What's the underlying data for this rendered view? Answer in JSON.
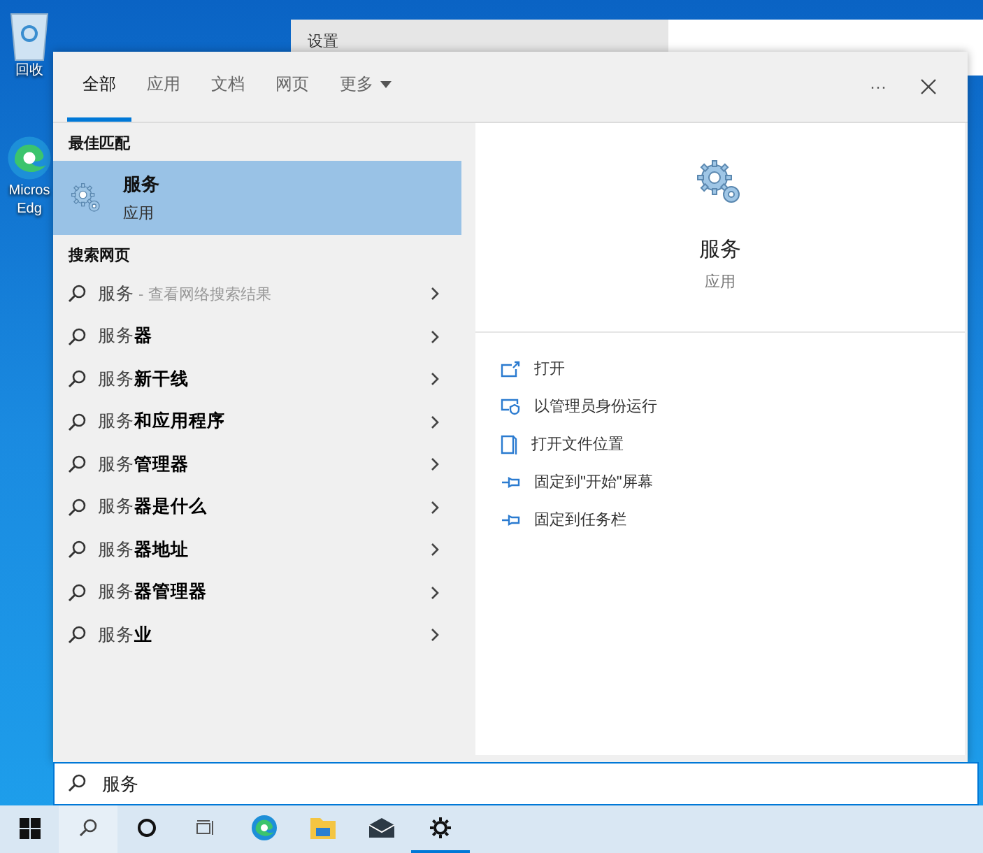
{
  "desktop_icons": [
    {
      "kind": "recycle",
      "label": "回收"
    },
    {
      "kind": "edge",
      "label": "Micros",
      "label_2": "Edg"
    }
  ],
  "background_window": {
    "title": "设置"
  },
  "search_panel": {
    "tabs": [
      {
        "label": "全部",
        "selected": true
      },
      {
        "label": "应用",
        "selected": false
      },
      {
        "label": "文档",
        "selected": false
      },
      {
        "label": "网页",
        "selected": false
      },
      {
        "label": "更多",
        "selected": false,
        "dropdown": true
      }
    ],
    "more_button": "···",
    "best_match": {
      "heading": "最佳匹配",
      "title": "服务",
      "subtitle": "应用",
      "selected": true
    },
    "web": {
      "heading": "搜索网页",
      "items": [
        {
          "text": "服务",
          "hint": " - 查看网络搜索结果"
        },
        {
          "text": "服务**器**"
        },
        {
          "text": "服务**新干线**"
        },
        {
          "text": "服务**和应用程序**"
        },
        {
          "text": "服务**管理器**"
        },
        {
          "text": "服务**器是什么**"
        },
        {
          "text": "服务**器地址**"
        },
        {
          "text": "服务**器管理器**"
        },
        {
          "text": "服务**业**"
        }
      ]
    },
    "preview": {
      "title": "服务",
      "subtitle": "应用",
      "actions": [
        {
          "kind": "open",
          "label": "打开"
        },
        {
          "kind": "admin",
          "label": "以管理员身份运行"
        },
        {
          "kind": "file",
          "label": "打开文件位置"
        },
        {
          "kind": "pin",
          "label": "固定到\"开始\"屏幕"
        },
        {
          "kind": "pin",
          "label": "固定到任务栏"
        }
      ]
    }
  },
  "search_box": {
    "value": "服务"
  },
  "taskbar": [
    {
      "kind": "start",
      "selected": false
    },
    {
      "kind": "search",
      "selected": true
    },
    {
      "kind": "cortana",
      "selected": false
    },
    {
      "kind": "taskview",
      "selected": false
    },
    {
      "kind": "edge",
      "selected": false
    },
    {
      "kind": "folder",
      "selected": false
    },
    {
      "kind": "mail",
      "selected": false
    },
    {
      "kind": "settings",
      "selected": true
    }
  ]
}
